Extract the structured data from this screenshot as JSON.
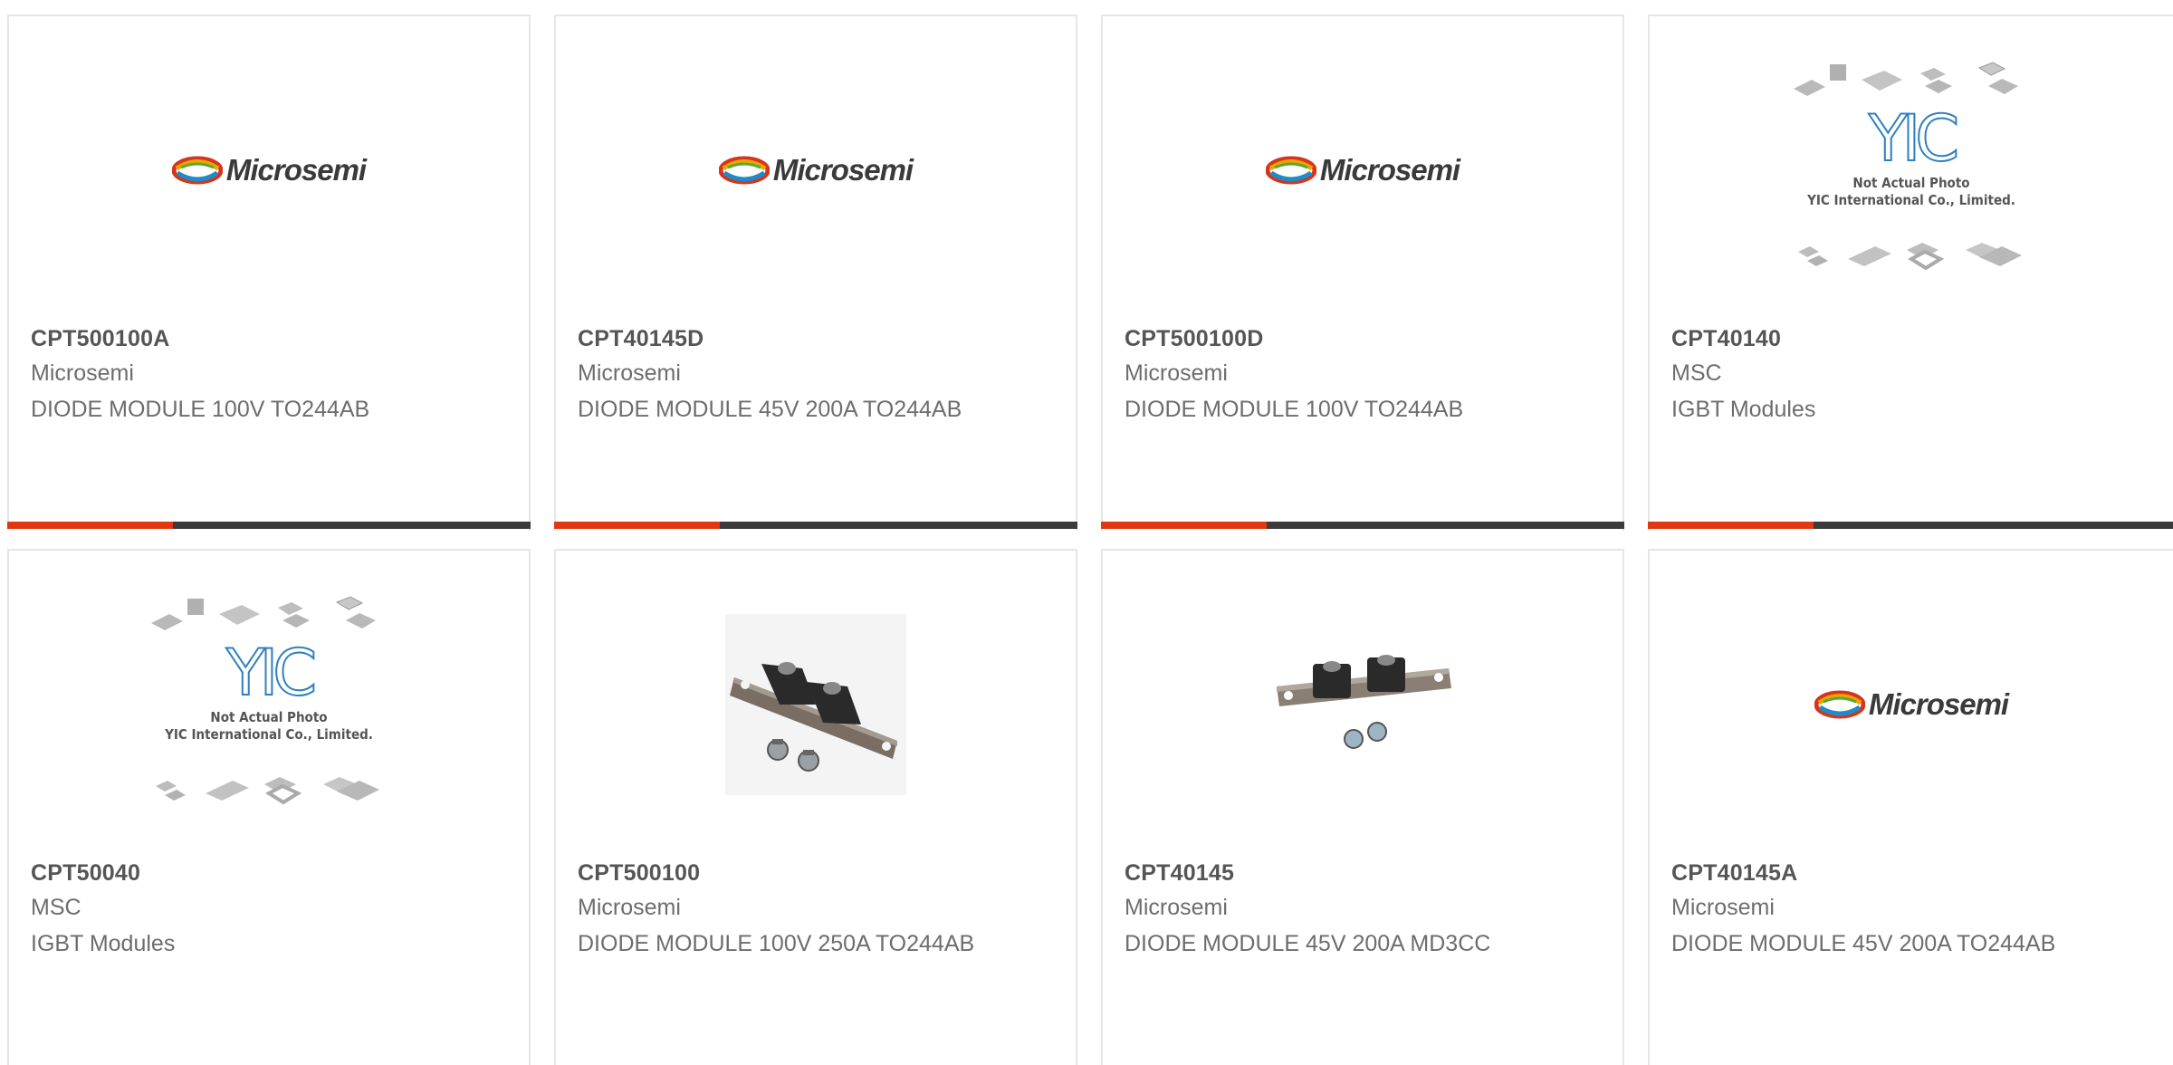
{
  "products": [
    {
      "part_number": "CPT500100A",
      "manufacturer": "Microsemi",
      "description": "DIODE MODULE 100V TO244AB",
      "image": "microsemi-logo",
      "logo_text": "Microsemi"
    },
    {
      "part_number": "CPT40145D",
      "manufacturer": "Microsemi",
      "description": "DIODE MODULE 45V 200A TO244AB",
      "image": "microsemi-logo",
      "logo_text": "Microsemi"
    },
    {
      "part_number": "CPT500100D",
      "manufacturer": "Microsemi",
      "description": "DIODE MODULE 100V TO244AB",
      "image": "microsemi-logo",
      "logo_text": "Microsemi"
    },
    {
      "part_number": "CPT40140",
      "manufacturer": "MSC",
      "description": "IGBT Modules",
      "image": "yic-placeholder",
      "placeholder_text": "Not Actual Photo",
      "placeholder_company": "YIC International Co., Limited."
    },
    {
      "part_number": "CPT50040",
      "manufacturer": "MSC",
      "description": "IGBT Modules",
      "image": "yic-placeholder",
      "placeholder_text": "Not Actual Photo",
      "placeholder_company": "YIC International Co., Limited."
    },
    {
      "part_number": "CPT500100",
      "manufacturer": "Microsemi",
      "description": "DIODE MODULE 100V 250A TO244AB",
      "image": "diode-module-photo"
    },
    {
      "part_number": "CPT40145",
      "manufacturer": "Microsemi",
      "description": "DIODE MODULE 45V 200A MD3CC",
      "image": "diode-module-photo"
    },
    {
      "part_number": "CPT40145A",
      "manufacturer": "Microsemi",
      "description": "DIODE MODULE 45V 200A TO244AB",
      "image": "microsemi-logo",
      "logo_text": "Microsemi"
    }
  ],
  "colors": {
    "accent": "#e0380f",
    "bar": "#3b3b3b",
    "text_bold": "#555555",
    "text": "#6d6d6d"
  }
}
